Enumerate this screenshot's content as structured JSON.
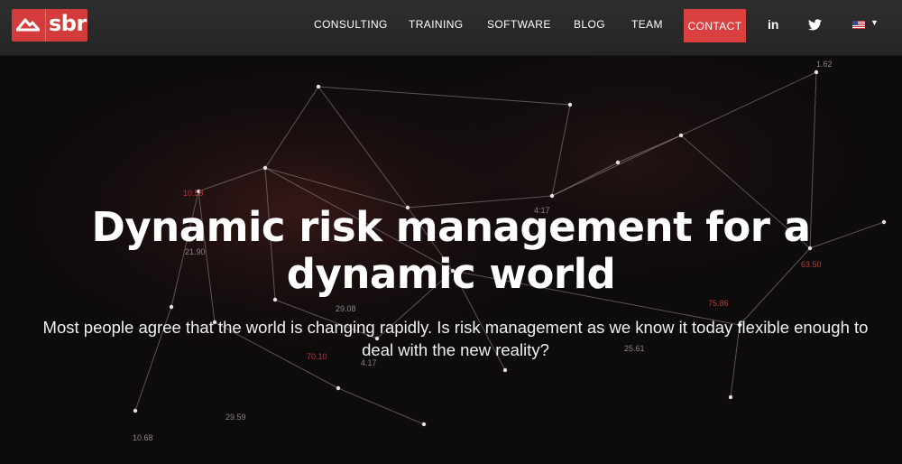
{
  "brand": {
    "logo_text": "sbr"
  },
  "nav": {
    "items": [
      "CONSULTING",
      "TRAINING",
      "SOFTWARE",
      "BLOG",
      "TEAM"
    ],
    "contact": "CONTACT",
    "linkedin": "in",
    "language": "English (US)"
  },
  "hero": {
    "title": "Dynamic risk management for a dynamic world",
    "subtitle": "Most people agree that the world is changing rapidly. Is risk management as we know it today flexible enough to deal with the new reality?"
  },
  "background_numbers": [
    "1.62",
    "4:17",
    "10.58",
    "21.90",
    "29.08",
    "70.10",
    "29.59",
    "10.68",
    "75.86",
    "4.17",
    "25.61",
    "63.50"
  ],
  "colors": {
    "accent": "#d9403f",
    "header": "#2a2a2a",
    "background": "#0d0a0a"
  }
}
